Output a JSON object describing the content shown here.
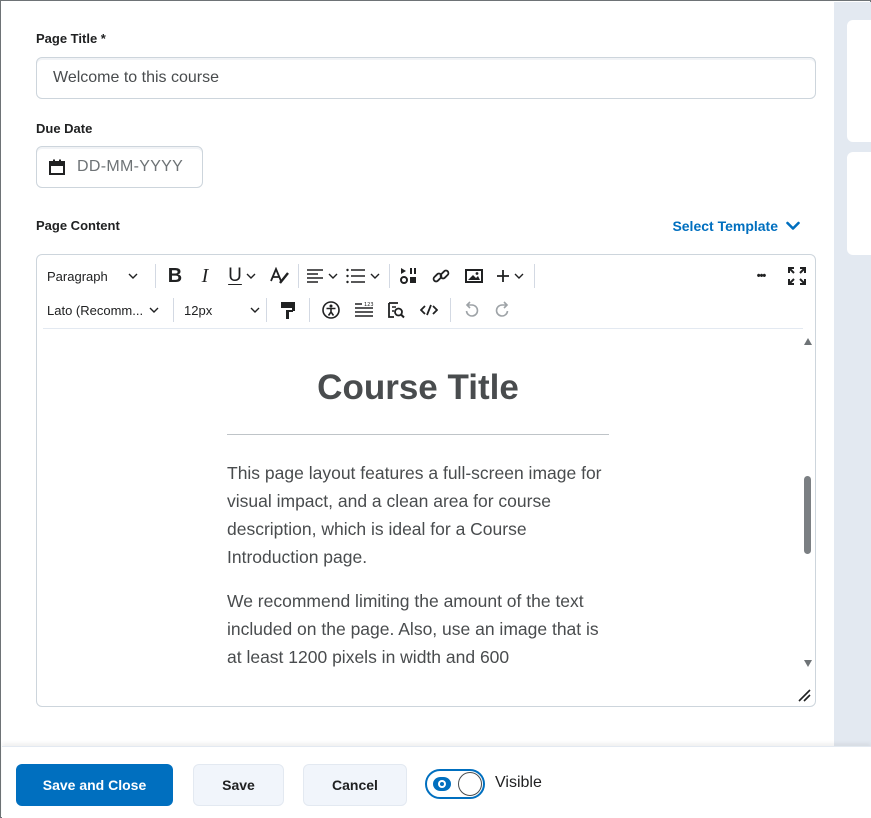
{
  "form": {
    "page_title_label": "Page Title *",
    "page_title_value": "Welcome to this course",
    "due_date_label": "Due Date",
    "due_date_placeholder": "DD-MM-YYYY",
    "page_content_label": "Page Content",
    "select_template_label": "Select Template"
  },
  "toolbar": {
    "format_select": "Paragraph",
    "bold": "B",
    "italic": "I",
    "underline": "U",
    "font_select": "Lato (Recomm...",
    "size_select": "12px",
    "more": "•••"
  },
  "editor": {
    "heading": "Course Title",
    "paragraph_1": "This page layout features a full-screen image for visual impact, and a clean area for course description, which is ideal for a Course Introduction page.",
    "paragraph_2": "We recommend limiting the amount of the text included on the page. Also, use an image that is at least 1200 pixels in width and 600"
  },
  "footer": {
    "save_close": "Save and Close",
    "save": "Save",
    "cancel": "Cancel",
    "visible_label": "Visible",
    "visible_on": true
  },
  "colors": {
    "accent": "#006fbf",
    "border": "#cdd5dc",
    "text": "#202122",
    "muted": "#494c4e"
  }
}
